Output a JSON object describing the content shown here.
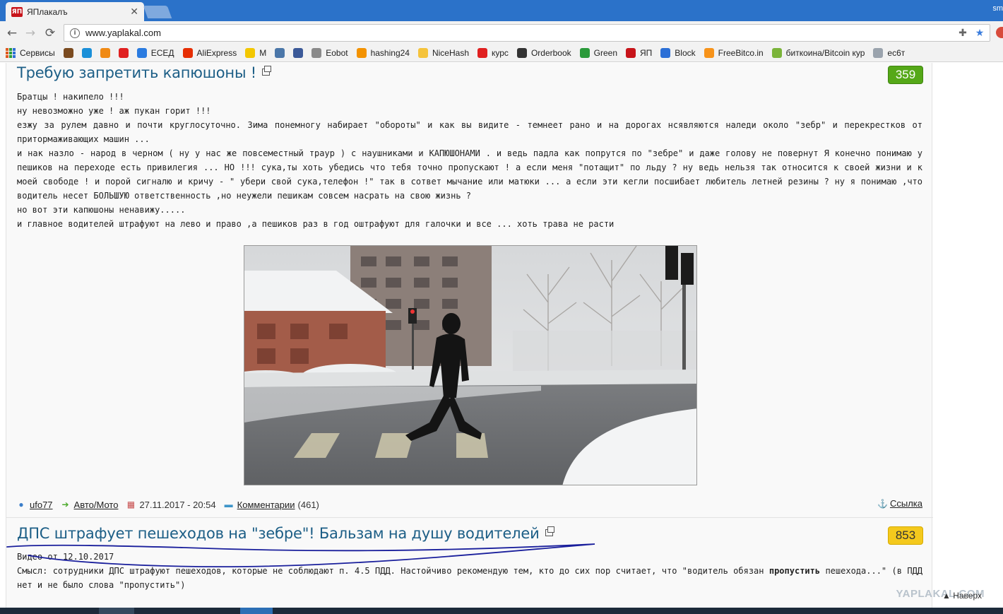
{
  "browser": {
    "tab_title": "ЯПлакалъ",
    "user_label": "sm",
    "url": "www.yaplakal.com"
  },
  "bookmarks": [
    {
      "label": "Сервисы",
      "icon": "apps-grid-icon",
      "color": "#e05a1f"
    },
    {
      "label": "",
      "icon": "cookie-icon",
      "color": "#7a4a1f"
    },
    {
      "label": "",
      "icon": "target-icon",
      "color": "#1a8fd8"
    },
    {
      "label": "",
      "icon": "music-icon",
      "color": "#f08a14"
    },
    {
      "label": "",
      "icon": "yandex-icon",
      "color": "#e02020"
    },
    {
      "label": "ЕСЕД",
      "icon": "phone-icon",
      "color": "#2a7be0"
    },
    {
      "label": "AliExpress",
      "icon": "aliexpress-icon",
      "color": "#e62e04"
    },
    {
      "label": "М",
      "icon": "smiley-icon",
      "color": "#f3c700"
    },
    {
      "label": "",
      "icon": "vk-icon",
      "color": "#4a76a8"
    },
    {
      "label": "",
      "icon": "facebook-icon",
      "color": "#3b5998"
    },
    {
      "label": "Eobot",
      "icon": "eobot-icon",
      "color": "#8a8a8a"
    },
    {
      "label": "hashing24",
      "icon": "hashing24-icon",
      "color": "#f39200"
    },
    {
      "label": "NiceHash",
      "icon": "nicehash-icon",
      "color": "#f5c33b"
    },
    {
      "label": "курс",
      "icon": "yandex-icon",
      "color": "#e02020"
    },
    {
      "label": "Orderbook",
      "icon": "orderbook-icon",
      "color": "#333333"
    },
    {
      "label": "Green",
      "icon": "green-icon",
      "color": "#2a9a3a"
    },
    {
      "label": "ЯП",
      "icon": "yaplakal-icon",
      "color": "#c7141a"
    },
    {
      "label": "Block",
      "icon": "block-icon",
      "color": "#2b6fd6"
    },
    {
      "label": "FreeBitco.in",
      "icon": "bitcoin-icon",
      "color": "#f7931a"
    },
    {
      "label": "биткоина/Bitcoin кур",
      "icon": "coin-icon",
      "color": "#7bb43a"
    },
    {
      "label": "ес6т",
      "icon": "gear-icon",
      "color": "#9aa3ad"
    }
  ],
  "post1": {
    "title": "Требую запретить капюшоны !",
    "rating": "359",
    "rating_color": "#55a818",
    "paragraphs": [
      "Братцы ! накипело !!!",
      "ну невозможно уже ! аж пукан горит !!!",
      "езжу за рулем давно и почти круглосуточно. Зима понемногу набирает \"обороты\" и как вы видите - темнеет рано и на дорогах нсявляются наледи около \"зебр\" и перекрестков от притормаживающих машин ...",
      "и нак назло - народ в черном ( ну у нас же повсеместный траур ) с наушниками и КАПЮШОНАМИ . и ведь падла как попрутся по \"зебре\" и даже голову не повернут Я конечно понимаю у пешиков на переходе есть привилегия ... НО !!! сука,ты хоть убедись что тебя точно пропускают ! а если меня \"потащит\" по льду ? ну ведь нельзя так относится к своей жизни и к моей свободе ! и порой сигналю и кричу - \" убери свой сука,телефон !\" так в сответ мычание или матюки ... а если эти кегли посшибает любитель летней резины ? ну я понимаю ,что водитель несет БОЛЬШУЮ ответственность ,но неужели пешикам совсем насрать на свою жизнь ?",
      "но вот эти капюшоны ненавижу.....",
      "и главное водителей штрафуют на лево и право ,а пешиков раз в год оштрафуют для галочки и все ... хоть трава не расти"
    ],
    "author": "ufo77",
    "category": "Авто/Мото",
    "date": "27.11.2017 - 20:54",
    "comments_label": "Комментарии",
    "comments_count": "(461)",
    "link_label": "Ссылка"
  },
  "post2": {
    "title": "ДПС штрафует пешеходов на \"зебре\"! Бальзам на душу водителей",
    "rating": "853",
    "rating_color": "#f4c91d",
    "date_line": "Видео от 12.10.2017",
    "body_pre": "Смысл: сотрудники ДПС штрафуют пешеходов, которые не соблюдают п. 4.5 ПДД. Настойчиво рекомендую тем, кто до сих пор считает, что \"водитель обязан ",
    "body_bold": "пропустить",
    "body_post": " пешехода...\" (в ПДД нет и не было слова \"пропустить\")"
  },
  "footer": {
    "watermark": "YAPLAKAL.COM",
    "to_top": "Наверх"
  }
}
